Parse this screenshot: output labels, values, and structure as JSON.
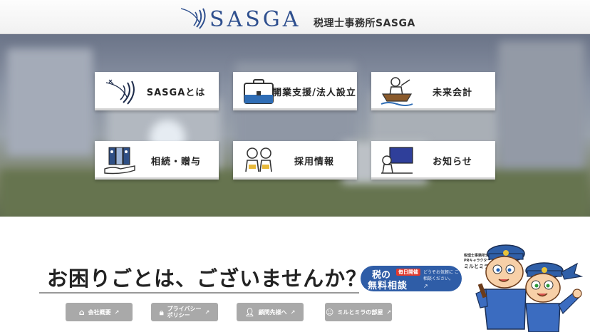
{
  "header": {
    "logo_text": "SASGA",
    "office_name": "税理士事務所SASGA"
  },
  "tiles": [
    {
      "label": "SASGAとは",
      "icon": "sasga-swoosh-icon"
    },
    {
      "label": "開業支援/法人設立",
      "icon": "briefcase-icon"
    },
    {
      "label": "未来会計",
      "icon": "boat-icon"
    },
    {
      "label": "相続・贈与",
      "icon": "binders-hand-icon"
    },
    {
      "label": "採用情報",
      "icon": "two-people-icon"
    },
    {
      "label": "お知らせ",
      "icon": "person-board-icon"
    }
  ],
  "main": {
    "question": "お困りごとは、ございませんか？"
  },
  "consult": {
    "tax": "税の",
    "badge": "毎日開催",
    "free": "無料相談",
    "note": "どうぞお気軽に ご相談ください。"
  },
  "footer_buttons": [
    {
      "label": "会社概要",
      "icon": "building-icon"
    },
    {
      "label": "プライバシー\nポリシー",
      "icon": "lock-icon"
    },
    {
      "label": "顧問先様へ",
      "icon": "person-icon"
    },
    {
      "label": "ミルとミラの部屋",
      "icon": "smile-icon"
    }
  ],
  "character": {
    "caption_line1": "税理士事務所SASGA",
    "caption_line2": "PRキャラクター",
    "name": "ミルとミラ"
  }
}
